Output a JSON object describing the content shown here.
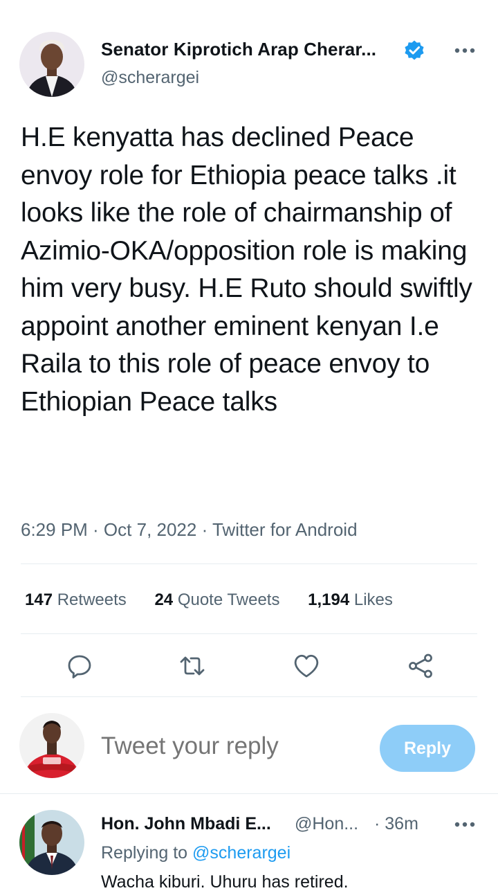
{
  "tweet": {
    "author_name": "Senator Kiprotich Arap Cherar...",
    "author_handle": "@scherargei",
    "verified": true,
    "text": "H.E kenyatta has declined Peace envoy role for Ethiopia peace talks .it looks like the role of chairmanship of Azimio-OKA/opposition role is making him very busy. H.E Ruto should swiftly appoint another eminent kenyan I.e Raila to this role of peace envoy to Ethiopian Peace talks",
    "meta": "6:29 PM · Oct 7, 2022 · Twitter for Android"
  },
  "stats": {
    "retweets_count": "147",
    "retweets_label": "Retweets",
    "quotes_count": "24",
    "quotes_label": "Quote Tweets",
    "likes_count": "1,194",
    "likes_label": "Likes"
  },
  "actions": [
    "reply-icon",
    "retweet-icon",
    "like-icon",
    "share-icon"
  ],
  "composer": {
    "placeholder": "Tweet your reply",
    "button_label": "Reply"
  },
  "reply": {
    "author_name": "Hon. John Mbadi E...",
    "author_handle": "@Hon...",
    "time": "· 36m",
    "replying_prefix": "Replying to",
    "replying_to": "@scherargei",
    "text": "Wacha kiburi. Uhuru has retired."
  },
  "colors": {
    "text": "#0f1419",
    "secondary": "#536471",
    "accent": "#1d9bf0",
    "reply_button_disabled": "#8ecdf8"
  }
}
